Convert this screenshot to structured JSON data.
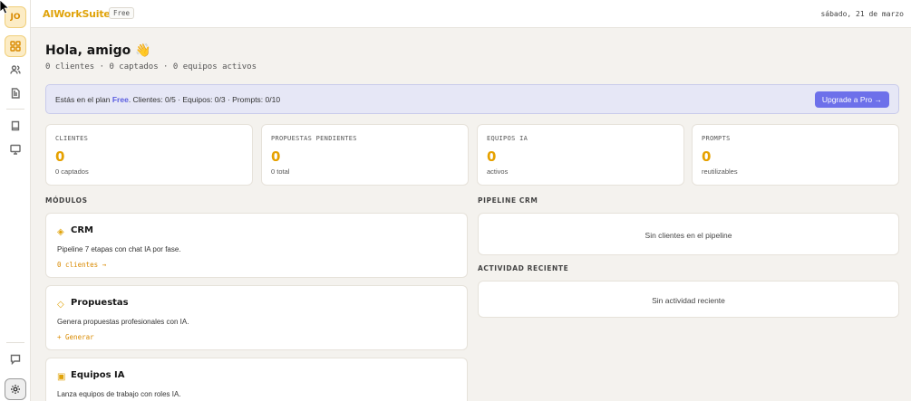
{
  "sidebar": {
    "avatar_initials": "JO",
    "icons": [
      "dashboard-icon",
      "users-icon",
      "document-icon",
      "book-icon",
      "monitor-icon",
      "chat-icon",
      "settings-icon"
    ]
  },
  "topbar": {
    "brand": "AIWorkSuite",
    "plan_badge": "Free",
    "date": "sábado, 21 de marzo"
  },
  "header": {
    "greeting": "Hola, amigo 👋",
    "summary": "0 clientes · 0 captados · 0 equipos activos"
  },
  "banner": {
    "prefix": "Estás en el plan ",
    "plan": "Free",
    "details": ". Clientes: 0/5 · Equipos: 0/3 · Prompts: 0/10",
    "upgrade_label": "Upgrade a Pro →"
  },
  "stats": [
    {
      "label": "CLIENTES",
      "value": "0",
      "sub": "0 captados"
    },
    {
      "label": "PROPUESTAS PENDIENTES",
      "value": "0",
      "sub": "0 total"
    },
    {
      "label": "EQUIPOS IA",
      "value": "0",
      "sub": "activos"
    },
    {
      "label": "PROMPTS",
      "value": "0",
      "sub": "reutilizables"
    }
  ],
  "modules_heading": "MÓDULOS",
  "modules": [
    {
      "icon": "◈",
      "title": "CRM",
      "desc": "Pipeline 7 etapas con chat IA por fase.",
      "link": "0 clientes →"
    },
    {
      "icon": "◇",
      "title": "Propuestas",
      "desc": "Genera propuestas profesionales con IA.",
      "link": "+ Generar"
    },
    {
      "icon": "▣",
      "title": "Equipos IA",
      "desc": "Lanza equipos de trabajo con roles IA.",
      "link": ""
    }
  ],
  "pipeline": {
    "heading": "PIPELINE CRM",
    "empty": "Sin clientes en el pipeline"
  },
  "activity": {
    "heading": "ACTIVIDAD RECIENTE",
    "empty": "Sin actividad reciente"
  },
  "colors": {
    "accent": "#e0a30a",
    "primary": "#6d70ea",
    "banner_bg": "#e6e7f6"
  }
}
